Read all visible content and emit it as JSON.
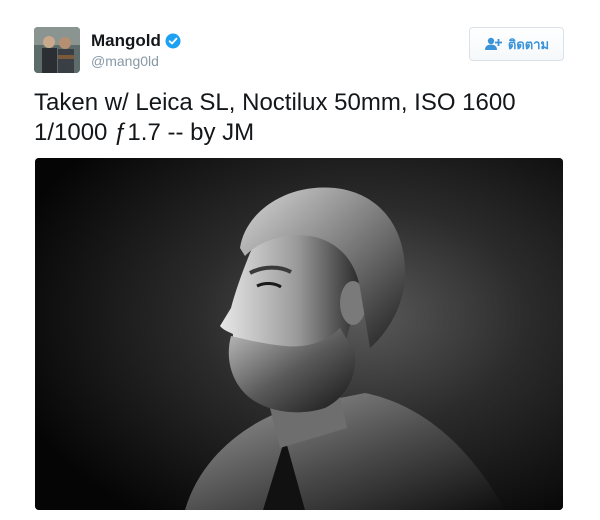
{
  "user": {
    "display_name": "Mangold",
    "handle": "@mang0ld",
    "verified": true
  },
  "follow_button": {
    "label": "ติดตาม",
    "icon": "follow-user-icon"
  },
  "tweet": {
    "text_line1": "Taken w/ Leica SL, Noctilux 50mm, ISO 1600",
    "text_line2": "1/1000 ƒ1.7 -- by JM"
  },
  "media": {
    "description_kind": "black-and-white portrait photo"
  },
  "colors": {
    "verified_blue": "#1da1f2",
    "follow_blue": "#3b94d9",
    "handle_gray": "#8899a6",
    "text_dark": "#14171a"
  }
}
